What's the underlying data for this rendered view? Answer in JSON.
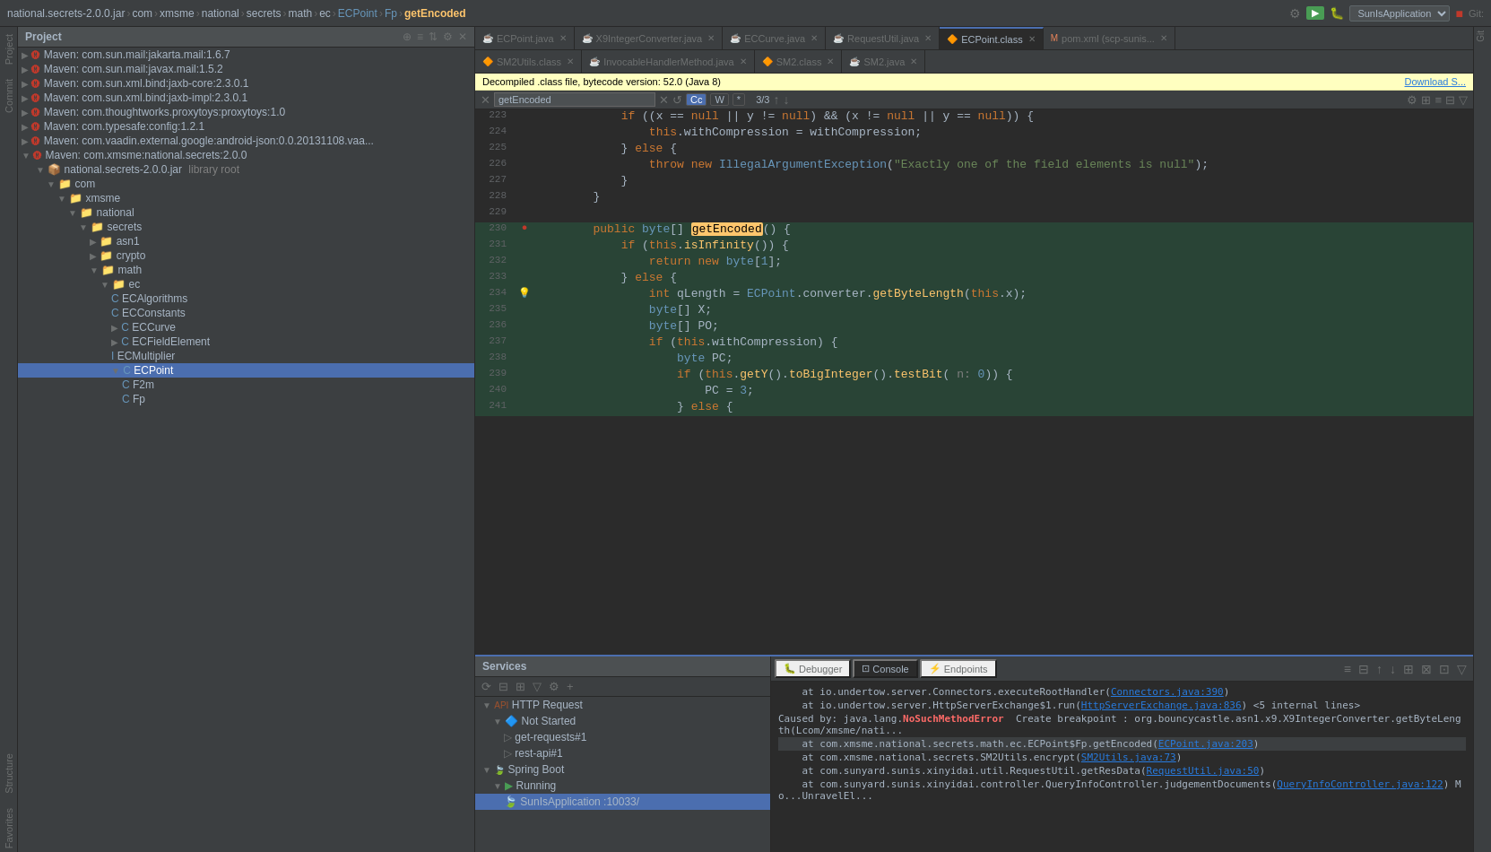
{
  "topbar": {
    "breadcrumb": [
      "national.secrets-2.0.0.jar",
      "com",
      "xmsme",
      "national",
      "secrets",
      "math",
      "ec",
      "ECPoint",
      "Fp",
      "getEncoded"
    ],
    "app": "SunIsApplication",
    "git_label": "Git:"
  },
  "project": {
    "title": "Project",
    "maven_items": [
      "Maven: com.sun.mail:jakarta.mail:1.6.7",
      "Maven: com.sun.mail:javax.mail:1.5.2",
      "Maven: com.sun.xml.bind:jaxb-core:2.3.0.1",
      "Maven: com.sun.xml.bind:jaxb-impl:2.3.0.1",
      "Maven: com.thoughtworks.proxytoys:proxytoys:1.0",
      "Maven: com.typesafe:config:1.2.1",
      "Maven: com.vaadin.external.google:android-json:0.0.20131108.vaa...",
      "Maven: com.xmsme:national.secrets:2.0.0"
    ],
    "tree": {
      "national_secrets_jar": "national.secrets-2.0.0.jar",
      "library_root": "library root",
      "com": "com",
      "xmsme": "xmsme",
      "national": "national",
      "secrets": "secrets",
      "asn1": "asn1",
      "crypto": "crypto",
      "math": "math",
      "ec": "ec",
      "ECAlgorithms": "ECAlgorithms",
      "ECConstants": "ECConstants",
      "ECCurve": "ECCurve",
      "ECFieldElement": "ECFieldElement",
      "ECMultiplier": "ECMultiplier",
      "ECPoint": "ECPoint",
      "F2m": "F2m",
      "Fp": "Fp"
    }
  },
  "tabs": {
    "row1": [
      {
        "label": "ECPoint.java",
        "type": "java",
        "active": false
      },
      {
        "label": "X9IntegerConverter.java",
        "type": "java",
        "active": false
      },
      {
        "label": "ECCurve.java",
        "type": "java",
        "active": false
      },
      {
        "label": "RequestUtil.java",
        "type": "java",
        "active": false
      },
      {
        "label": "ECPoint.class",
        "type": "class",
        "active": true
      },
      {
        "label": "pom.xml (scp-sunis...",
        "type": "xml",
        "active": false
      }
    ],
    "row2": [
      {
        "label": "SM2Utils.class",
        "type": "class",
        "active": false
      },
      {
        "label": "InvocableHandlerMethod.java",
        "type": "java",
        "active": false
      },
      {
        "label": "SM2.class",
        "type": "class",
        "active": false
      },
      {
        "label": "SM2.java",
        "type": "java",
        "active": false
      }
    ]
  },
  "info_bar": {
    "message": "Decompiled .class file, bytecode version: 52.0 (Java 8)",
    "download": "Download S..."
  },
  "search": {
    "query": "getEncoded",
    "count": "3/3",
    "buttons": [
      "Cc",
      "W",
      "*"
    ]
  },
  "code": {
    "lines": [
      {
        "num": "223",
        "content": "            if ((x == null || y != null) && (x != null || y == null)) {"
      },
      {
        "num": "224",
        "content": "                this.withCompression = withCompression;"
      },
      {
        "num": "225",
        "content": "            } else {"
      },
      {
        "num": "226",
        "content": "                throw new IllegalArgumentException(\"Exactly one of the field elements is null\");"
      },
      {
        "num": "227",
        "content": "            }"
      },
      {
        "num": "228",
        "content": "        }"
      },
      {
        "num": "229",
        "content": ""
      },
      {
        "num": "230",
        "content": "        public byte[] getEncoded() {",
        "highlight": true,
        "breakpoint": true
      },
      {
        "num": "231",
        "content": "            if (this.isInfinity()) {"
      },
      {
        "num": "232",
        "content": "                return new byte[1];"
      },
      {
        "num": "233",
        "content": "            } else {"
      },
      {
        "num": "234",
        "content": "                int qLength = ECPoint.converter.getByteLength(this.x);",
        "warning": true
      },
      {
        "num": "235",
        "content": "                byte[] X;"
      },
      {
        "num": "236",
        "content": "                byte[] PO;"
      },
      {
        "num": "237",
        "content": "                if (this.withCompression) {"
      },
      {
        "num": "238",
        "content": "                    byte PC;"
      },
      {
        "num": "239",
        "content": "                    if (this.getY().toBigInteger().testBit( n: 0)) {"
      },
      {
        "num": "240",
        "content": "                        PC = 3;"
      },
      {
        "num": "241",
        "content": "                    } else {"
      }
    ]
  },
  "bottom": {
    "services_label": "Services",
    "tabs": [
      "Debugger",
      "Console",
      "Endpoints"
    ],
    "services_tree": {
      "http_request": "HTTP Request",
      "not_started": "Not Started",
      "get_requests": "get-requests#1",
      "rest_api": "rest-api#1",
      "spring_boot": "Spring Boot",
      "running": "Running",
      "sun_is_app": "SunIsApplication :10033/"
    },
    "log_lines": [
      "    at io.undertow.server.Connectors.executeRootHandler(Connectors.java:390)",
      "    at io.undertow.server.HttpServerExchange$1.run(HttpServerExchange.java:836) <5 internal lines>",
      "Caused by: java.lang.NoSuchMethodError  Create breakpoint : org.bouncycastle.asn1.x9.X9IntegerConverter.getByteLength(Lcom/xmsme/nati...",
      "    at com.xmsme.national.secrets.math.ec.ECPoint$Fp.getEncoded(ECPoint.java:203)",
      "    at com.xmsme.national.secrets.SM2Utils.encrypt(SM2Utils.java:73)",
      "    at com.sunyard.sunis.xinyidai.util.RequestUtil.getResData(RequestUtil.java:50)",
      "    at com.sunyard.sunis.xinyidai.controller.QueryInfoController.judgementDocuments(QueryInfoController.java:122) Mo...UnravelEl..."
    ]
  }
}
